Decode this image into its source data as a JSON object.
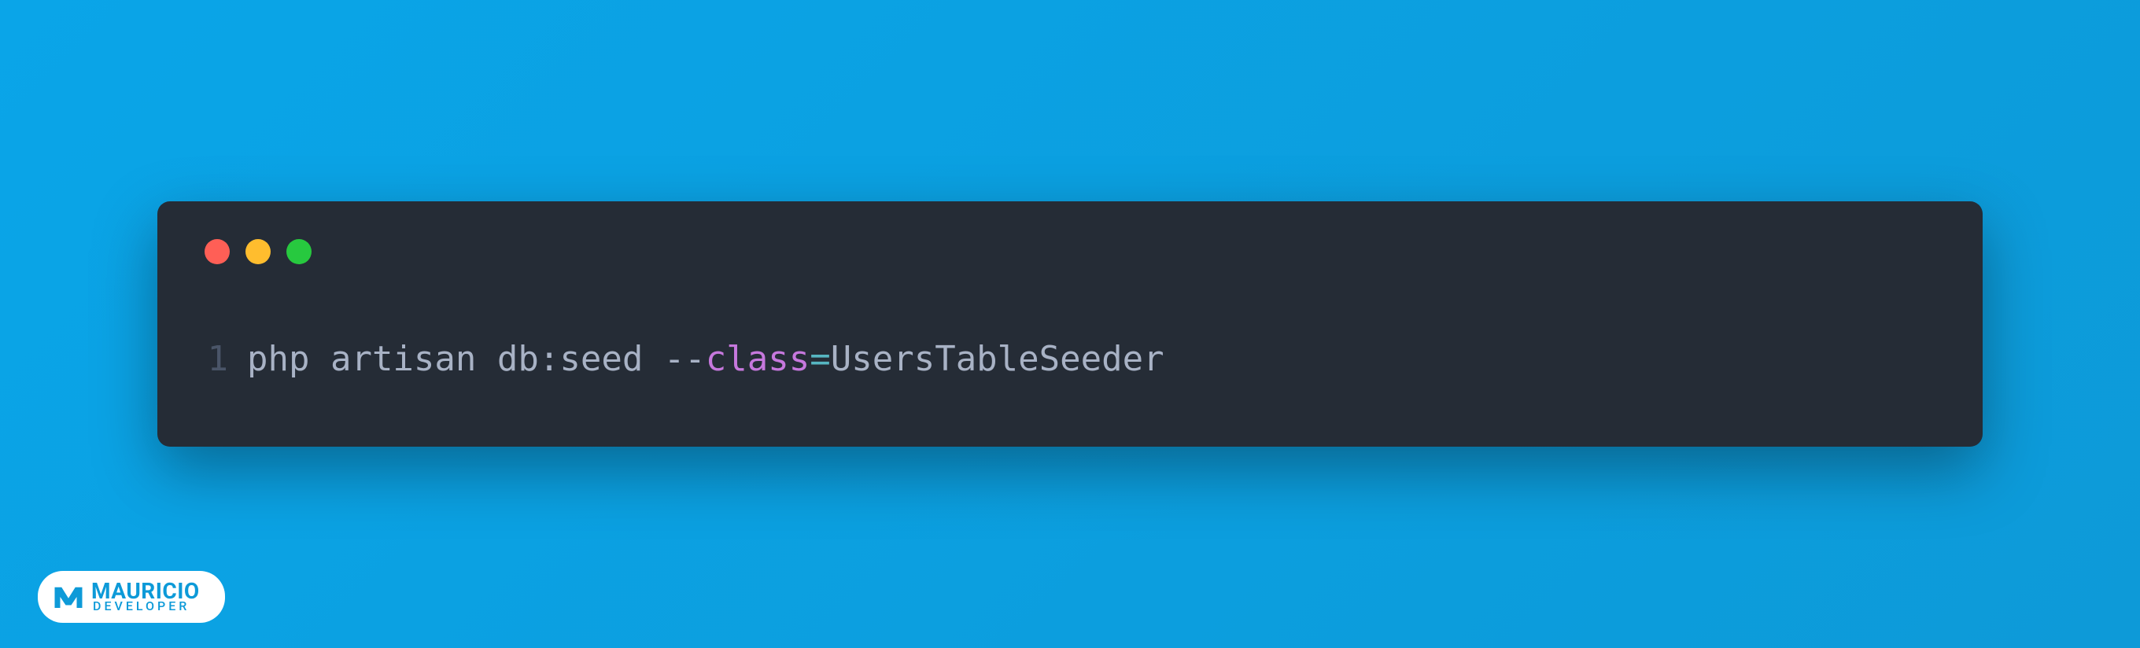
{
  "code": {
    "line_number": "1",
    "tokens": {
      "cmd_prefix": "php artisan db:seed ",
      "dashes": "--",
      "keyword": "class",
      "equals": "=",
      "value": "UsersTableSeeder"
    }
  },
  "watermark": {
    "name": "MAURICIO",
    "title": "DEVELOPER"
  }
}
